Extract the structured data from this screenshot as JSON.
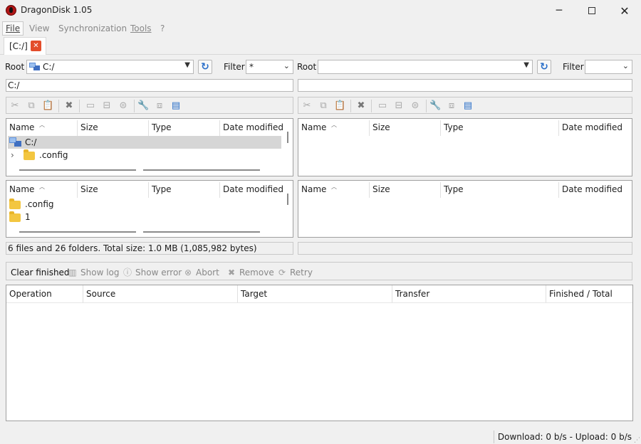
{
  "app": {
    "title": "DragonDisk 1.05"
  },
  "menu": {
    "file": "File",
    "view": "View",
    "sync": "Synchronization",
    "tools": "Tools",
    "help": "?"
  },
  "tabs": [
    {
      "label": "[C:/]"
    }
  ],
  "left": {
    "root_label": "Root",
    "root_value": "C:/",
    "filter_label": "Filter",
    "filter_value": "*",
    "path": "C:/",
    "columns": [
      "Name",
      "Size",
      "Type",
      "Date modified"
    ],
    "tree_rows": [
      "C:/",
      ".config"
    ],
    "list_rows": [
      ".config",
      "1"
    ],
    "status": "6 files and 26 folders. Total size: 1.0 MB (1,085,982 bytes)"
  },
  "right": {
    "root_label": "Root",
    "root_value": "",
    "filter_label": "Filter",
    "filter_value": "",
    "path": "",
    "columns": [
      "Name",
      "Size",
      "Type",
      "Date modified"
    ],
    "status": ""
  },
  "queue": {
    "buttons": [
      "Clear finished",
      "Show log",
      "Show error",
      "Abort",
      "Remove",
      "Retry"
    ],
    "columns": [
      "Operation",
      "Source",
      "Target",
      "Transfer",
      "Finished / Total"
    ]
  },
  "statusbar": {
    "network": "Download: 0 b/s - Upload: 0 b/s"
  },
  "colors": {
    "accent": "#2a6fc9",
    "tab_close": "#e34d2b",
    "folder": "#f3c640",
    "app_icon": "#b01717"
  }
}
